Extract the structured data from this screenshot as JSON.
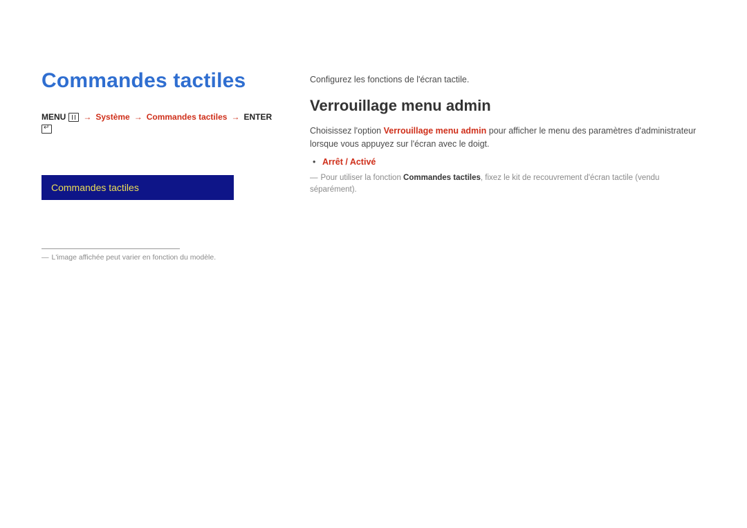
{
  "left": {
    "title": "Commandes tactiles",
    "breadcrumb": {
      "menu_label": "MENU",
      "arrow": "→",
      "path1": "Système",
      "path2": "Commandes tactiles",
      "enter_label": "ENTER"
    },
    "menu_item": "Commandes tactiles",
    "footnote": "L'image affichée peut varier en fonction du modèle."
  },
  "right": {
    "intro": "Configurez les fonctions de l'écran tactile.",
    "heading": "Verrouillage menu admin",
    "desc_prefix": "Choisissez l'option ",
    "desc_highlight": "Verrouillage menu admin",
    "desc_suffix": " pour afficher le menu des paramètres d'administrateur lorsque vous appuyez sur l'écran avec le doigt.",
    "options": "Arrêt / Activé",
    "note_prefix": "Pour utiliser la fonction ",
    "note_bold": "Commandes tactiles",
    "note_suffix": ", fixez le kit de recouvrement d'écran tactile (vendu séparément)."
  }
}
